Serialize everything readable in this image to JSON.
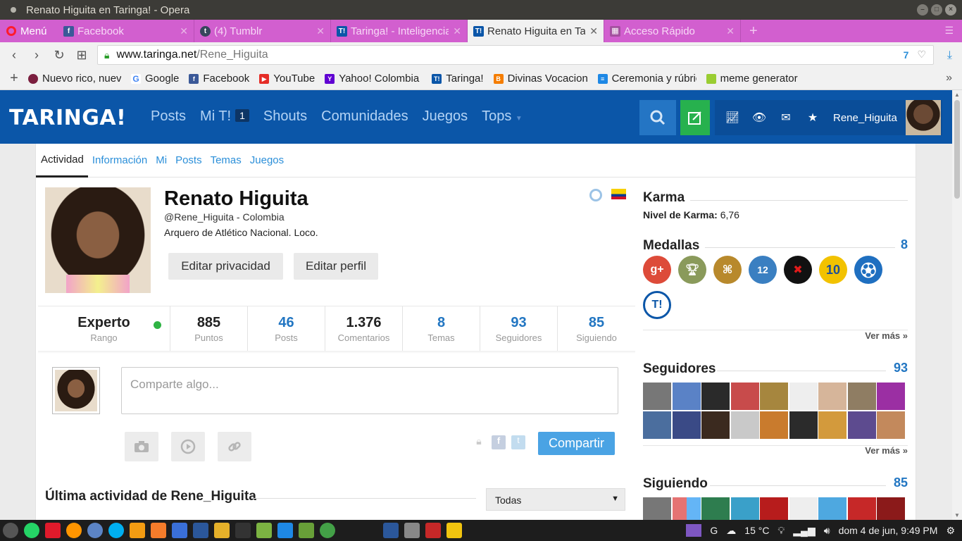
{
  "window": {
    "title": "Renato Higuita en Taringa! - Opera"
  },
  "tabs": {
    "menu_label": "Menú",
    "items": [
      {
        "label": "Facebook",
        "active": false
      },
      {
        "label": "(4) Tumblr",
        "active": false
      },
      {
        "label": "Taringa! - Inteligencia",
        "active": false
      },
      {
        "label": "Renato Higuita en Taringa",
        "active": true
      },
      {
        "label": "Acceso Rápido",
        "active": false
      }
    ]
  },
  "address": {
    "host": "www.taringa.net",
    "path": "/Rene_Higuita",
    "badge": "7"
  },
  "bookmarks": [
    {
      "label": "Nuevo rico, nuevo",
      "color": "#7b1f3f"
    },
    {
      "label": "Google",
      "color": "#4285f4"
    },
    {
      "label": "Facebook",
      "color": "#3b5998"
    },
    {
      "label": "YouTube",
      "color": "#e52d27"
    },
    {
      "label": "Yahoo! Colombia",
      "color": "#6001d2"
    },
    {
      "label": "Taringa!",
      "color": "#0b56a8"
    },
    {
      "label": "Divinas Vocaciones",
      "color": "#f57d00"
    },
    {
      "label": "Ceremonia y rúbrica",
      "color": "#1e88e5"
    },
    {
      "label": "meme generator",
      "color": "#9acd32"
    }
  ],
  "site": {
    "logo": "TARINGA!",
    "nav": [
      {
        "label": "Posts"
      },
      {
        "label": "Mi T!",
        "count": "1"
      },
      {
        "label": "Shouts"
      },
      {
        "label": "Comunidades"
      },
      {
        "label": "Juegos"
      },
      {
        "label": "Tops"
      }
    ],
    "username": "Rene_Higuita"
  },
  "profile": {
    "subtabs": [
      "Actividad",
      "Información",
      "Mi",
      "Posts",
      "Temas",
      "Juegos"
    ],
    "name": "Renato Higuita",
    "handle": "@Rene_Higuita - Colombia",
    "bio": "Arquero de Atlético Nacional. Loco.",
    "btn_privacy": "Editar privacidad",
    "btn_profile": "Editar perfil",
    "stats": [
      {
        "value": "Experto",
        "label": "Rango"
      },
      {
        "value": "885",
        "label": "Puntos"
      },
      {
        "value": "46",
        "label": "Posts"
      },
      {
        "value": "1.376",
        "label": "Comentarios"
      },
      {
        "value": "8",
        "label": "Temas"
      },
      {
        "value": "93",
        "label": "Seguidores"
      },
      {
        "value": "85",
        "label": "Siguiendo"
      }
    ],
    "share_placeholder": "Comparte algo...",
    "share_button": "Compartir",
    "activity_title": "Última actividad de Rene_Higuita",
    "activity_filter": "Todas"
  },
  "sidebar": {
    "karma_title": "Karma",
    "karma_label": "Nivel de Karma:",
    "karma_value": "6,76",
    "medals_title": "Medallas",
    "medals_count": "8",
    "medals": [
      {
        "text": "g+",
        "color": "#dd4b39"
      },
      {
        "text": "",
        "color": "#8a9a5b"
      },
      {
        "text": "",
        "color": "#b8892c"
      },
      {
        "text": "12",
        "color": "#3a7fc1"
      },
      {
        "text": "✖",
        "color": "#111111"
      },
      {
        "text": "10",
        "color": "#f2c200"
      },
      {
        "text": "",
        "color": "#1f6fc0"
      },
      {
        "text": "T!",
        "color": "#0b56a8"
      }
    ],
    "see_more": "Ver más »",
    "followers_title": "Seguidores",
    "followers_count": "93",
    "following_title": "Siguiendo",
    "following_count": "85"
  },
  "taskbar": {
    "temp": "15 °C",
    "datetime": "dom 4 de jun, 9:49 PM"
  }
}
